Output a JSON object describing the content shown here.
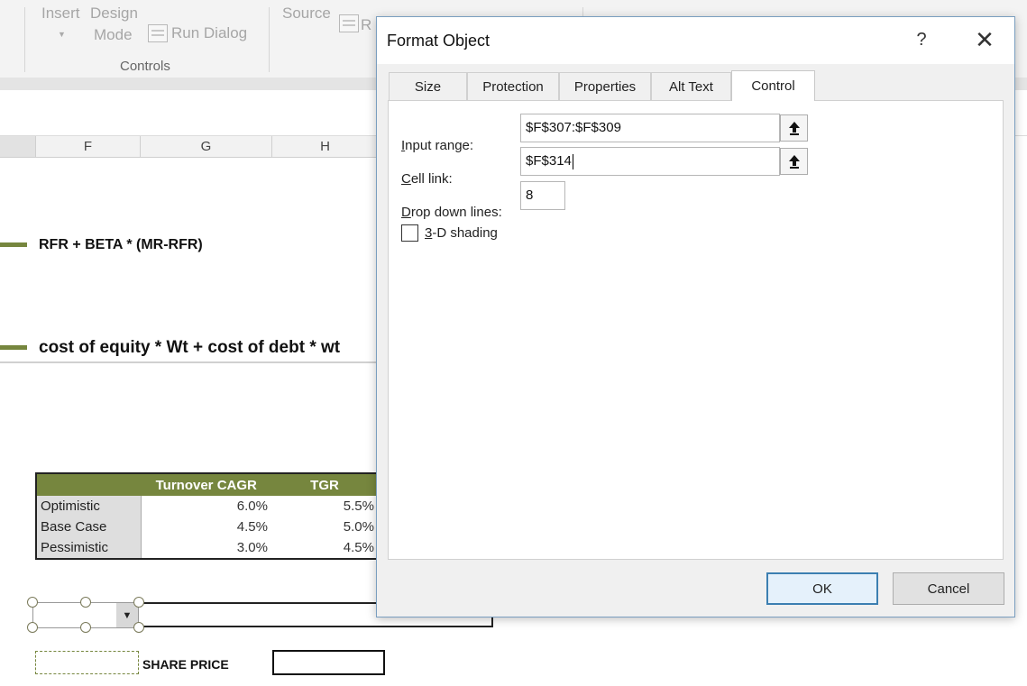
{
  "ribbon": {
    "insert_label": "Insert",
    "design_label": "Design",
    "mode_label": "Mode",
    "run_dialog_label": "Run Dialog",
    "controls_group": "Controls",
    "source_label": "Source",
    "refresh_partial": "R"
  },
  "columns": [
    "F",
    "G",
    "H"
  ],
  "sheet": {
    "formula1": "RFR + BETA * (MR-RFR)",
    "formula2": "cost of equity * Wt + cost of debt * wt",
    "scenario_table": {
      "headers": [
        "",
        "Turnover CAGR",
        "TGR"
      ],
      "rows": [
        {
          "label": "Optimistic",
          "cagr": "6.0%",
          "tgr": "5.5%"
        },
        {
          "label": "Base Case",
          "cagr": "4.5%",
          "tgr": "5.0%"
        },
        {
          "label": "Pessimistic",
          "cagr": "3.0%",
          "tgr": "4.5%"
        }
      ]
    },
    "share_price_label": "SHARE PRICE"
  },
  "dialog": {
    "title": "Format Object",
    "help": "?",
    "close": "✕",
    "tabs": [
      "Size",
      "Protection",
      "Properties",
      "Alt Text",
      "Control"
    ],
    "active_tab": "Control",
    "input_range_label_key": "I",
    "input_range_label_rest": "nput range:",
    "input_range_value": "$F$307:$F$309",
    "cell_link_label_key": "C",
    "cell_link_label_rest": "ell link:",
    "cell_link_value": "$F$314",
    "drop_down_label_key": "D",
    "drop_down_label_rest": "rop down lines:",
    "drop_down_value": "8",
    "shading_label_key": "3",
    "shading_label_rest": "-D shading",
    "ok_label": "OK",
    "cancel_label": "Cancel"
  },
  "colors": {
    "header_green": "#76863e",
    "ok_border": "#3c7fb1"
  },
  "icons": [
    "run-dialog-icon",
    "refresh-icon",
    "collapse-dialog-icon",
    "dropdown-arrow-icon",
    "close-icon",
    "help-icon"
  ]
}
